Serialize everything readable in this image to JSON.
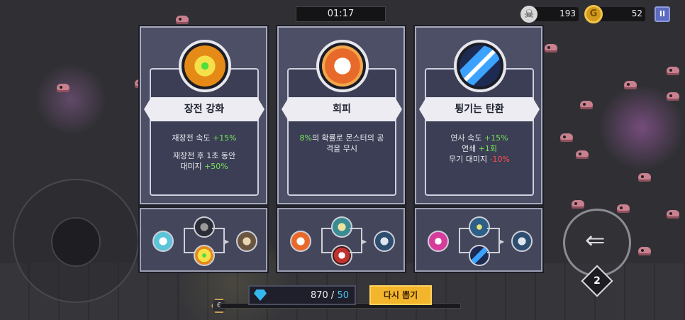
{
  "hud": {
    "timer": "01:17",
    "kills": "193",
    "coins": "52",
    "coin_glyph": "G",
    "pause_glyph": "II",
    "dash_charges": "2",
    "level": "6"
  },
  "cards": [
    {
      "title": "장전 강화",
      "icon": "green-burst-icon",
      "lines": [
        {
          "text": "재장전 속도 ",
          "value": "+15%"
        },
        {
          "text": "재장전 후 1초 동안",
          "value": ""
        },
        {
          "text": "대미지 ",
          "value": "+50%"
        }
      ]
    },
    {
      "title": "회피",
      "icon": "dodge-cat-icon",
      "lines": [
        {
          "value": "8%",
          "text": "의 확률로 몬스터의 공"
        },
        {
          "text": "격을 무시",
          "value": ""
        }
      ]
    },
    {
      "title": "튕기는 탄환",
      "icon": "bouncing-bullet-icon",
      "lines": [
        {
          "text": "연사 속도 ",
          "value": "+15%"
        },
        {
          "text": "연쇄 ",
          "value": "+1회"
        },
        {
          "text": "무기 대미지 ",
          "value": "-10%"
        }
      ]
    }
  ],
  "bottom": {
    "gems_current": "870",
    "gems_separator": " / ",
    "gems_max": "50",
    "reroll_label": "다시 뽑기"
  },
  "colors": {
    "positive": "#76e25a",
    "negative": "#ff4e4e",
    "gem": "#35b8ee",
    "reroll": "#f3b52b"
  }
}
